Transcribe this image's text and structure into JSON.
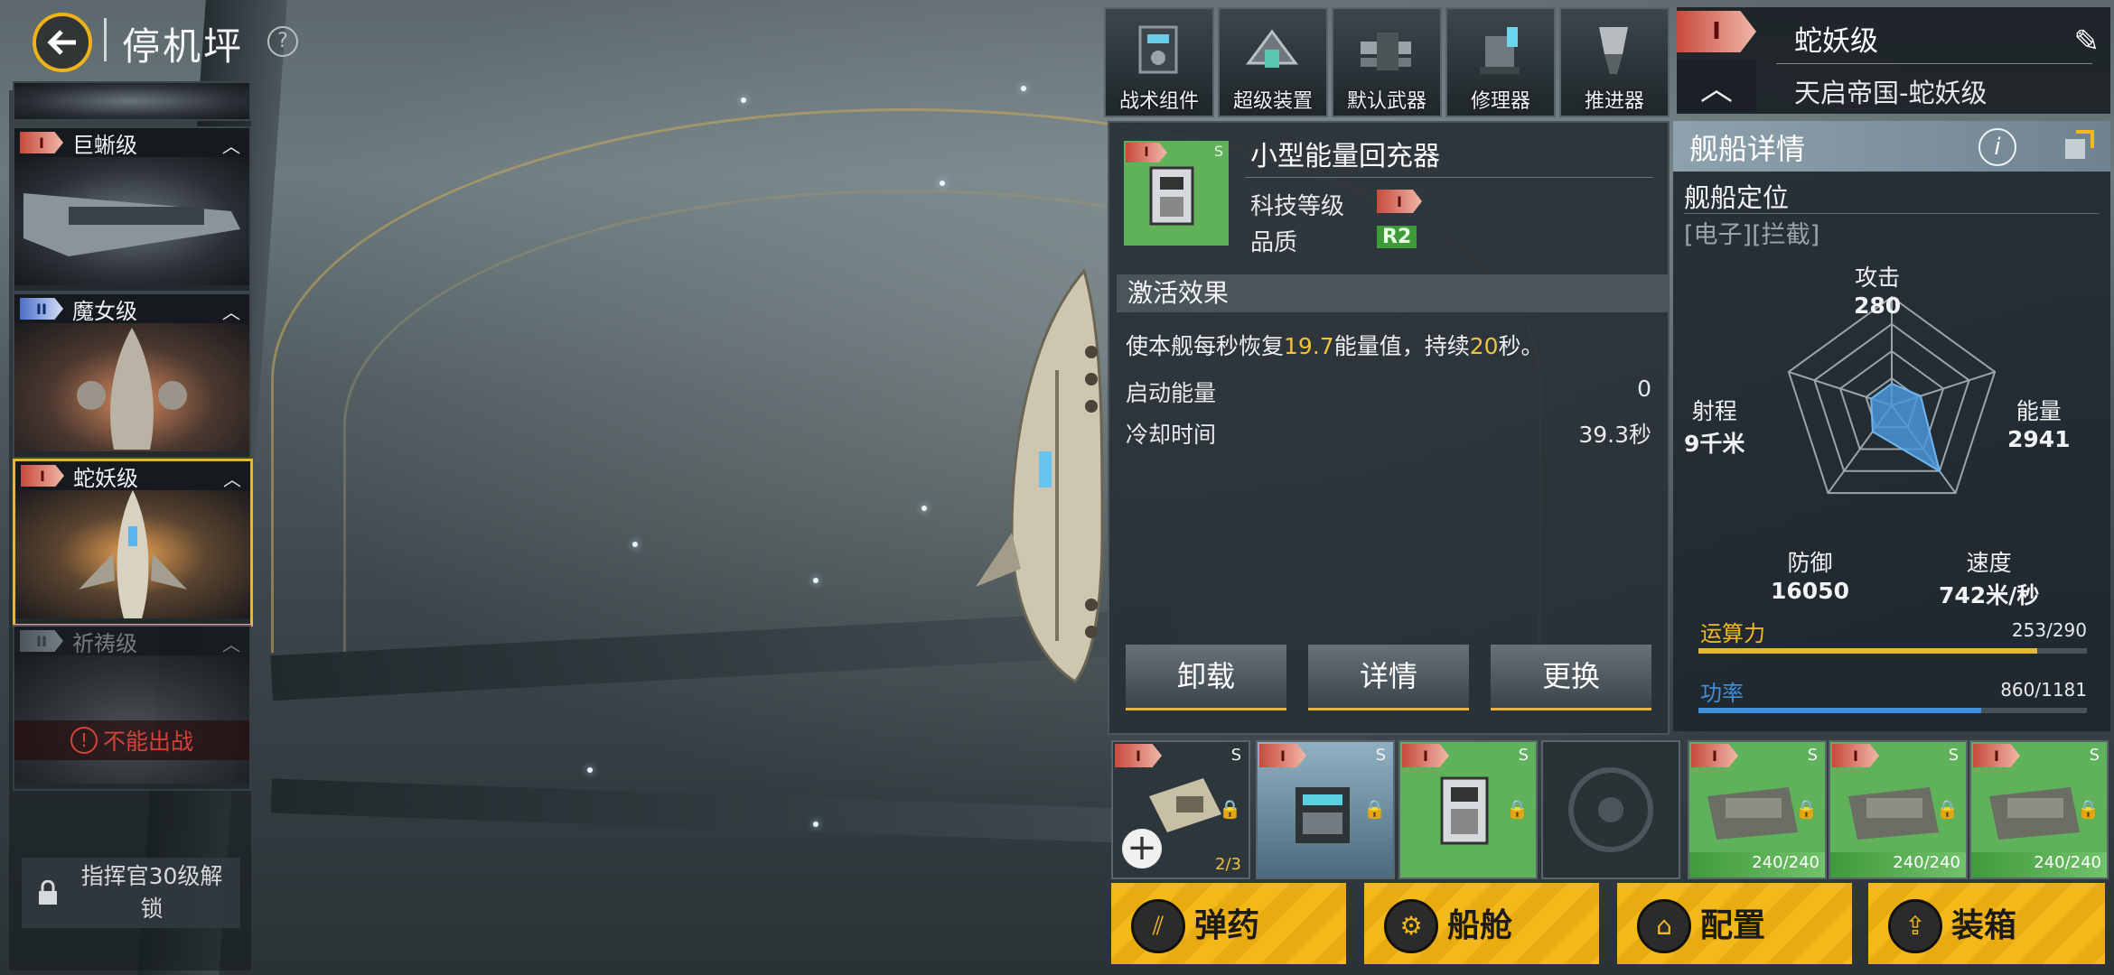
{
  "header": {
    "title": "停机坪"
  },
  "ships": [
    {
      "tier": "I",
      "name": "巨蜥级",
      "state": "normal"
    },
    {
      "tier": "II",
      "name": "魔女级",
      "state": "normal"
    },
    {
      "tier": "I",
      "name": "蛇妖级",
      "state": "selected"
    },
    {
      "tier": "II",
      "name": "祈祷级",
      "state": "locked",
      "warning": "不能出战"
    }
  ],
  "lock_slot": {
    "text": "指挥官30级解锁"
  },
  "tabs": [
    {
      "label": "战术组件",
      "icon": "tactical-module-icon"
    },
    {
      "label": "超级装置",
      "icon": "super-device-icon"
    },
    {
      "label": "默认武器",
      "icon": "default-weapon-icon"
    },
    {
      "label": "修理器",
      "icon": "repair-device-icon"
    },
    {
      "label": "推进器",
      "icon": "thruster-icon"
    }
  ],
  "ship_header": {
    "tier": "I",
    "class_name": "蛇妖级",
    "full_name": "天启帝国-蛇妖级"
  },
  "module": {
    "name": "小型能量回充器",
    "slot_type": "S",
    "tech_label": "科技等级",
    "tech_value": "I",
    "quality_label": "品质",
    "quality_value": "R2",
    "effect_title": "激活效果",
    "effect_prefix": "使本舰每秒恢复",
    "effect_value": "19.7",
    "effect_mid": "能量值，持续",
    "effect_duration": "20",
    "effect_suffix": "秒。",
    "start_energy_label": "启动能量",
    "start_energy_value": "0",
    "cooldown_label": "冷却时间",
    "cooldown_value": "39.3秒",
    "buttons": {
      "unload": "卸载",
      "details": "详情",
      "replace": "更换"
    }
  },
  "ship_detail": {
    "title": "舰船详情",
    "role_label": "舰船定位",
    "tags": "[电子][拦截]",
    "stats": {
      "attack": {
        "label": "攻击",
        "value": "280"
      },
      "energy": {
        "label": "能量",
        "value": "2941"
      },
      "speed": {
        "label": "速度",
        "value": "742米/秒"
      },
      "defense": {
        "label": "防御",
        "value": "16050"
      },
      "range": {
        "label": "射程",
        "value": "9千米"
      }
    },
    "radar_values": {
      "attack": 0.2,
      "energy": 0.28,
      "speed": 0.75,
      "defense": 0.3,
      "range": 0.2
    },
    "compute": {
      "label": "运算力",
      "current": 253,
      "max": 290,
      "text": "253/290"
    },
    "power": {
      "label": "功率",
      "current": 860,
      "max": 1181,
      "text": "860/1181"
    }
  },
  "slots": [
    {
      "tier": "I",
      "size": "S",
      "count": "2/3",
      "style": "dark",
      "icon": "missile-module-icon"
    },
    {
      "tier": "I",
      "size": "S",
      "style": "blue",
      "icon": "device-module-icon"
    },
    {
      "tier": "I",
      "size": "S",
      "style": "green",
      "icon": "energy-charger-icon"
    },
    {
      "style": "empty",
      "icon": "empty-slot-icon"
    },
    {
      "tier": "I",
      "size": "S",
      "hp": "240/240",
      "style": "green",
      "icon": "turret-icon"
    },
    {
      "tier": "I",
      "size": "S",
      "hp": "240/240",
      "style": "green",
      "icon": "turret-icon"
    },
    {
      "tier": "I",
      "size": "S",
      "hp": "240/240",
      "style": "green",
      "icon": "turret-icon"
    }
  ],
  "actions": [
    {
      "label": "弹药",
      "icon": "ammo-icon"
    },
    {
      "label": "船舱",
      "icon": "cabin-icon"
    },
    {
      "label": "配置",
      "icon": "config-icon"
    },
    {
      "label": "装箱",
      "icon": "crate-icon"
    }
  ],
  "colors": {
    "accent": "#f3b819",
    "energy_bar": "#e8b53a",
    "power_bar": "#3f8fd9",
    "radar_fill": "#4a95d6"
  }
}
